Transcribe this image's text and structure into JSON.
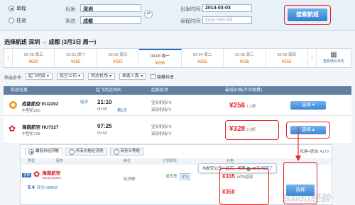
{
  "search": {
    "trip_oneway": "单程",
    "trip_round": "往返",
    "from_label": "出发:",
    "from_value": "深圳",
    "to_label": "到达:",
    "to_value": "成都",
    "depart_label": "出发时间:",
    "depart_value": "2014-03-03",
    "return_label": "返程时间:",
    "return_placeholder": "yyyy-mm-dd",
    "search_button": "搜索航班",
    "swap_icon": "⇄"
  },
  "title": "选择航班  深圳 → 成都  (3月3日 周一)",
  "dates": [
    {
      "date": "02-28 周五",
      "price": "¥620"
    },
    {
      "date": "03-01 周六",
      "price": "¥365"
    },
    {
      "date": "03-02 周日",
      "price": "¥335"
    },
    {
      "date": "03-03 周一",
      "price": "¥256"
    },
    {
      "date": "03-04 周二",
      "price": "¥256"
    },
    {
      "date": "03-05 周三",
      "price": "¥256"
    },
    {
      "date": "03-06 周四",
      "price": "¥256"
    }
  ],
  "calendar_label": "查看低价日历",
  "filters": {
    "label": "筛选条件:",
    "depart_time": "起飞时段",
    "airline": "航空公司",
    "airport": "到达机场",
    "passengers": "乘客人数",
    "share": "隐藏共享"
  },
  "table_header": {
    "flight": "航班信息",
    "time": "起飞到达时间",
    "airport": "起抵机场",
    "price": "最低价格(不含税费)"
  },
  "flights": [
    {
      "airline": "成都航空 EU2202",
      "model": "中型机320",
      "meal": "经济",
      "dep": "21:10",
      "arr": "00:05",
      "arr_tag": "第2天",
      "dep_airport": "宝安机场T3",
      "arr_airport": "双流机场T2",
      "price": "¥256",
      "discount": "1.1折",
      "button": "选择"
    },
    {
      "airline": "海南航空 HU7327",
      "model": "中型机738",
      "dep": "07:25",
      "arr": "09:50",
      "dep_airport": "宝安机场T3",
      "arr_airport": "双流机场T2",
      "price": "¥328",
      "discount": "2.3折",
      "button": "选择"
    }
  ],
  "expanded": {
    "tab1": "最低价经济舱",
    "tab2": "所有价格经济舱",
    "tab3": "商务头等舱",
    "tax": "机建+燃油: ¥170",
    "sub_headers": [
      "类型",
      "服务",
      "舱位",
      "订票机票",
      "价格"
    ],
    "tooltip_text": "与航空公司一起买，机票",
    "tooltip_coupon": "15元",
    "tooltip_link": "知道了",
    "badge": "官网",
    "logo_cn": "海南航空",
    "logo_en": "Hainan Airlines",
    "rating": "9.4",
    "reviews": "评分(18459)",
    "cabin": "经济舱",
    "rule": "退改签",
    "tag": "保险",
    "price1": "¥335",
    "return_note": "+¥20返现",
    "price2": "¥350"
  },
  "watermark": "Baidu经验"
}
